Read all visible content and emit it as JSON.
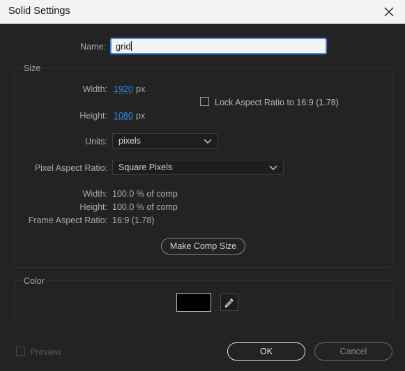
{
  "window": {
    "title": "Solid Settings"
  },
  "name_field": {
    "label": "Name:",
    "value": "grid"
  },
  "size": {
    "section_label": "Size",
    "width_label": "Width:",
    "width_value": "1920",
    "width_unit": "px",
    "height_label": "Height:",
    "height_value": "1080",
    "height_unit": "px",
    "lock_label": "Lock Aspect Ratio to 16:9 (1.78)",
    "lock_checked": false,
    "units_label": "Units:",
    "units_value": "pixels",
    "par_label": "Pixel Aspect Ratio:",
    "par_value": "Square Pixels",
    "comp_width_label": "Width:",
    "comp_width_value": "100.0 % of comp",
    "comp_height_label": "Height:",
    "comp_height_value": "100.0 % of comp",
    "frame_ar_label": "Frame Aspect Ratio:",
    "frame_ar_value": "16:9 (1.78)",
    "make_comp_size_label": "Make Comp Size"
  },
  "color": {
    "section_label": "Color",
    "swatch_color": "#000000",
    "accent": "#2d8ceb"
  },
  "footer": {
    "preview_label": "Preview",
    "preview_checked": false,
    "ok_label": "OK",
    "cancel_label": "Cancel"
  },
  "icons": {
    "close": "close-icon",
    "chevron": "chevron-down-icon",
    "eyedropper": "eyedropper-icon"
  }
}
